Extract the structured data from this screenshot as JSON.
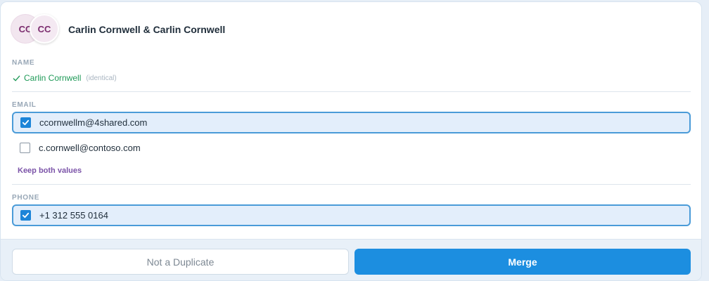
{
  "header": {
    "avatar_1_initials": "CC",
    "avatar_2_initials": "CC",
    "title": "Carlin Cornwell & Carlin Cornwell"
  },
  "name_section": {
    "label": "NAME",
    "value": "Carlin Cornwell",
    "note": "(identical)"
  },
  "email_section": {
    "label": "EMAIL",
    "options": [
      {
        "value": "ccornwellm@4shared.com",
        "checked": true
      },
      {
        "value": "c.cornwell@contoso.com",
        "checked": false
      }
    ],
    "keep_both_label": "Keep both values"
  },
  "phone_section": {
    "label": "PHONE",
    "options": [
      {
        "value": "+1 312 555 0164",
        "checked": true
      }
    ]
  },
  "footer": {
    "not_duplicate_label": "Not a Duplicate",
    "merge_label": "Merge"
  },
  "colors": {
    "primary": "#1c8ee0",
    "check_green": "#1f9a58",
    "link_purple": "#7b53a8",
    "avatar_text": "#7b2c6e"
  }
}
